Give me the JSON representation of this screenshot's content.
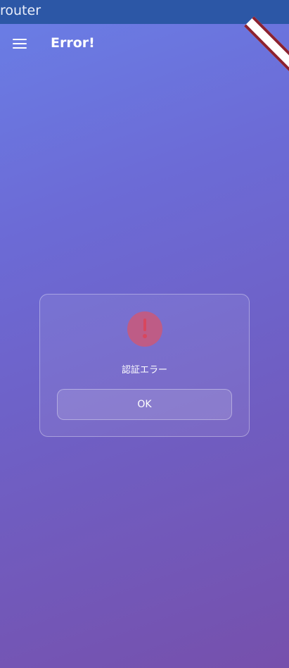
{
  "window": {
    "title": "router"
  },
  "appbar": {
    "title": "Error!",
    "menu_icon": "hamburger-menu-icon"
  },
  "dialog": {
    "icon": "alert-exclamation-icon",
    "message": "認証エラー",
    "ok_label": "OK"
  },
  "colors": {
    "titlebar": "#2c57a6",
    "gradient_top": "#6a7fe6",
    "gradient_bottom": "#7650ac",
    "alert": "#d8475e",
    "debug_ribbon": "#8c2230"
  }
}
